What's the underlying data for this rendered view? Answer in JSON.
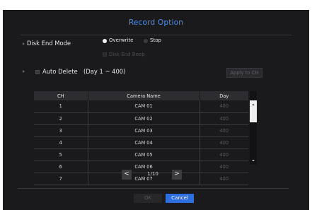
{
  "dialog": {
    "title": "Record Option"
  },
  "disk_end_mode": {
    "label": "Disk End Mode",
    "options": [
      {
        "label": "Overwrite",
        "selected": true
      },
      {
        "label": "Stop",
        "selected": false
      }
    ],
    "beep_label": "Disk End Beep"
  },
  "auto_delete": {
    "label": "Auto Delete",
    "range": "(Day 1 ~ 400)",
    "apply_label": "Apply to CH"
  },
  "table": {
    "headers": [
      "CH",
      "Camera Name",
      "Day"
    ],
    "rows": [
      {
        "ch": "1",
        "name": "CAM 01",
        "day": "400"
      },
      {
        "ch": "2",
        "name": "CAM 02",
        "day": "400"
      },
      {
        "ch": "3",
        "name": "CAM 03",
        "day": "400"
      },
      {
        "ch": "4",
        "name": "CAM 04",
        "day": "400"
      },
      {
        "ch": "5",
        "name": "CAM 05",
        "day": "400"
      },
      {
        "ch": "6",
        "name": "CAM 06",
        "day": "400"
      },
      {
        "ch": "7",
        "name": "CAM 07",
        "day": "400"
      }
    ]
  },
  "pagination": {
    "prev": "<",
    "page": "1/10",
    "next": ">"
  },
  "footer": {
    "ok_label": "OK",
    "cancel_label": "Cancel"
  },
  "colors": {
    "accent": "#2d6fe0",
    "title": "#4f8ff0",
    "background": "#1a1a1d"
  }
}
